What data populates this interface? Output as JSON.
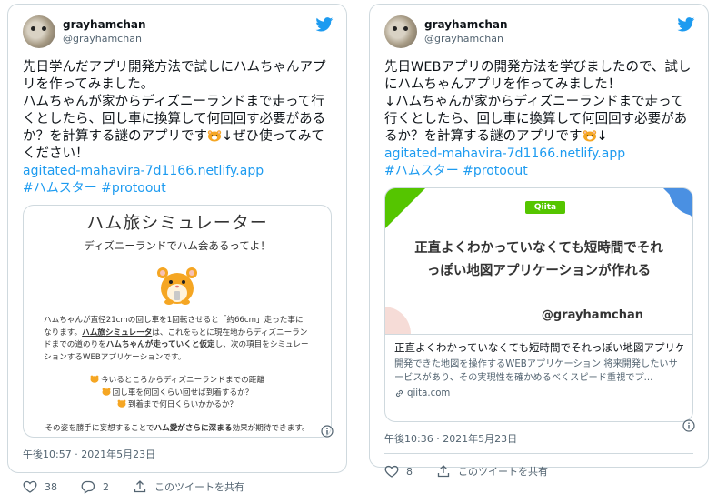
{
  "tweets": [
    {
      "display_name": "grayhamchan",
      "handle": "@grayhamchan",
      "text_before_emoji": "先日学んだアプリ開発方法で試しにハムちゃんアプリを作ってみました。\nハムちゃんが家からディズニーランドまで走って行くとしたら、回し車に換算して何回回す必要があるか？を計算する謎のアプリです",
      "text_after_emoji": "↓ぜひ使ってみてください！",
      "link": "agitated-mahavira-7d1166.netlify.app",
      "hashtags": "#ハムスター #protoout",
      "card": {
        "title": "ハム旅シミュレーター",
        "subtitle": "ディズニーランドでハム会あるってよ！",
        "para_1": "ハムちゃんが直径21cmの回し車を1回転させると「約66cm」走った事になります。",
        "para_bold_1": "ハム旅シミュレータ",
        "para_2": "は、これをもとに現在地からディズニーランドまでの道のりを",
        "para_bold_2": "ハムちゃんが走っていくと仮定",
        "para_3": "し、次の項目をシミュレーションするWEBアプリケーションです。",
        "list": [
          "今いるところからディズニーランドまでの距離",
          "回し車を何回くらい回せば到着するか？",
          "到着まで何日くらいかかるか？"
        ],
        "end_1": "その姿を勝手に妄想することで",
        "end_bold_1": "ハム愛がさらに深まる",
        "end_2": "効果が期待できます。"
      },
      "timestamp": "午後10:57 · 2021年5月23日",
      "likes": "38",
      "replies": "2",
      "share_label": "このツイートを共有"
    },
    {
      "display_name": "grayhamchan",
      "handle": "@grayhamchan",
      "text_before_emoji": "先日WEBアプリの開発方法を学びましたので、試しにハムちゃんアプリを作ってみました！\n↓ハムちゃんが家からディズニーランドまで走って行くとしたら、回し車に換算して何回回す必要があるか？を計算する謎のアプリです",
      "text_after_emoji": "↓",
      "link": "agitated-mahavira-7d1166.netlify.app",
      "hashtags": "#ハムスター #protoout",
      "card": {
        "logo": "Qiita",
        "image_title": "正直よくわかっていなくても短時間でそれっぽい地図アプリケーションが作れる",
        "image_user": "@grayhamchan",
        "title": "正直よくわかっていなくても短時間でそれっぽい地図アプリケ...",
        "description": "開発できた地図を操作するWEBアプリケーション 将来開発したいサービスがあり、その実現性を確かめるべくスピード重視でプ...",
        "domain": "qiita.com"
      },
      "timestamp": "午後10:36 · 2021年5月23日",
      "likes": "8",
      "share_label": "このツイートを共有"
    }
  ],
  "colors": {
    "accent": "#1d9bf0",
    "text": "#0f1419",
    "muted": "#536471",
    "border": "#cfd9de",
    "qiita_green": "#55c500",
    "hamster_orange": "#f5a623"
  }
}
